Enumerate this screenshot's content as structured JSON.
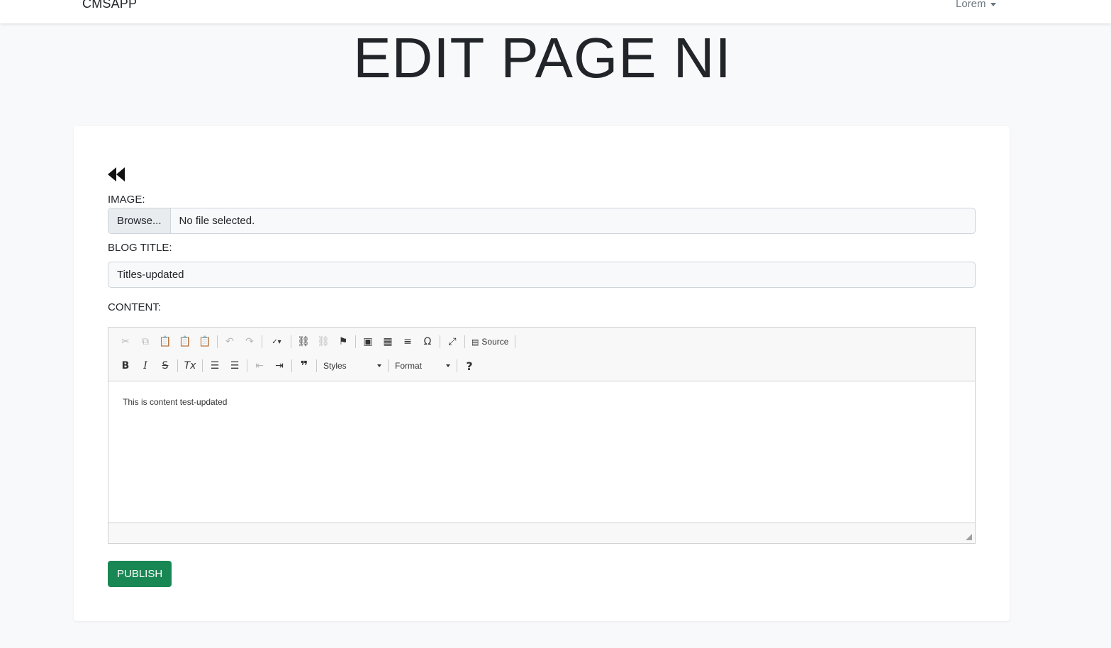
{
  "navbar": {
    "brand": "CMSAPP",
    "user": "Lorem"
  },
  "page": {
    "title": "EDIT PAGE NI"
  },
  "form": {
    "image_label": "IMAGE:",
    "browse_label": "Browse...",
    "file_status": "No file selected.",
    "blog_title_label": "BLOG TITLE:",
    "blog_title_value": "Titles-updated",
    "content_label": "CONTENT:",
    "publish_label": "PUBLISH"
  },
  "editor": {
    "source_label": "Source",
    "styles_label": "Styles",
    "format_label": "Format",
    "content": "This is content test-updated"
  },
  "colors": {
    "publish": "#198754",
    "background": "#f8f9fa"
  }
}
